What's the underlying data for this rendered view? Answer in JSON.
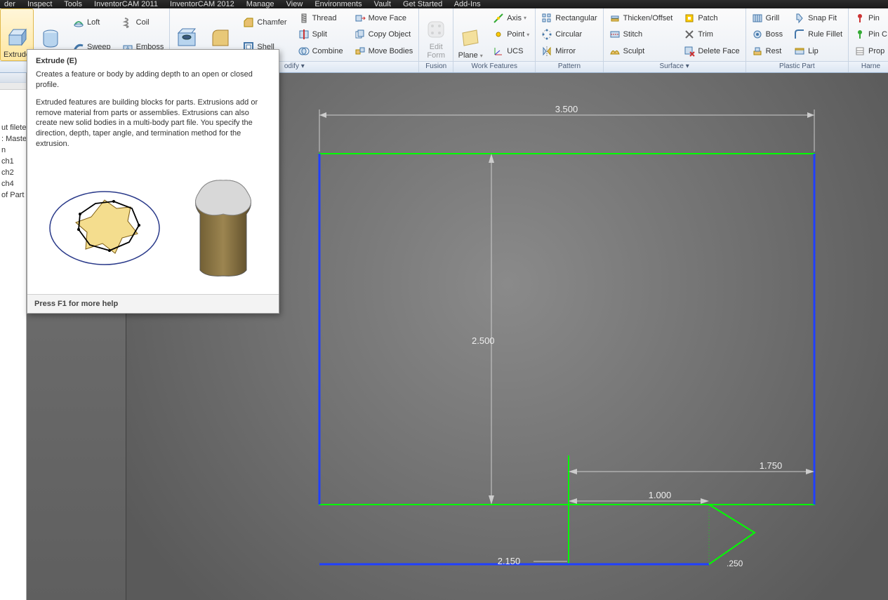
{
  "menu": {
    "items": [
      "der",
      "Inspect",
      "Tools",
      "InventorCAM 2011",
      "InventorCAM 2012",
      "Manage",
      "View",
      "Environments",
      "Vault",
      "Get Started",
      "Add-Ins"
    ]
  },
  "ribbon": {
    "groups": [
      {
        "label": "",
        "big": [
          {
            "name": "extrude-button",
            "text": "Extrude",
            "selected": true,
            "icon": "extrude"
          },
          {
            "name": "revolve-button",
            "text": "Revolve",
            "icon": "revolve"
          }
        ],
        "cols": [
          [
            {
              "name": "loft-button",
              "text": "Loft",
              "icon": "loft"
            },
            {
              "name": "sweep-button",
              "text": "Sweep",
              "icon": "sweep"
            }
          ],
          [
            {
              "name": "coil-button",
              "text": "Coil",
              "icon": "coil"
            },
            {
              "name": "emboss-button",
              "text": "Emboss",
              "icon": "emboss"
            }
          ]
        ]
      },
      {
        "label": "",
        "big": [
          {
            "name": "hole-button",
            "text": "Hole",
            "icon": "hole"
          },
          {
            "name": "fillet-button",
            "text": "Fillet",
            "icon": "fillet",
            "dd": true
          }
        ],
        "cols": [
          [
            {
              "name": "chamfer-button",
              "text": "Chamfer",
              "icon": "chamfer"
            },
            {
              "name": "shell-button",
              "text": "Shell",
              "icon": "shell"
            }
          ],
          [
            {
              "name": "thread-button",
              "text": "Thread",
              "icon": "thread"
            },
            {
              "name": "split-button",
              "text": "Split",
              "icon": "split"
            },
            {
              "name": "combine-button",
              "text": "Combine",
              "icon": "combine"
            }
          ],
          [
            {
              "name": "moveface-button",
              "text": "Move Face",
              "icon": "moveface"
            },
            {
              "name": "copyobject-button",
              "text": "Copy Object",
              "icon": "copy"
            },
            {
              "name": "movebodies-button",
              "text": "Move Bodies",
              "icon": "movebodies"
            }
          ]
        ],
        "partial_label": "odify ▾"
      },
      {
        "label": "Fusion",
        "big": [
          {
            "name": "editform-button",
            "text": "Edit\nForm",
            "icon": "editform",
            "disabled": true
          }
        ]
      },
      {
        "label": "Work Features",
        "big": [
          {
            "name": "plane-button",
            "text": "Plane",
            "icon": "plane",
            "dd": true
          }
        ],
        "cols": [
          [
            {
              "name": "axis-button",
              "text": "Axis",
              "icon": "axis",
              "dd": true
            },
            {
              "name": "point-button",
              "text": "Point",
              "icon": "point",
              "dd": true
            },
            {
              "name": "ucs-button",
              "text": "UCS",
              "icon": "ucs"
            }
          ]
        ]
      },
      {
        "label": "Pattern",
        "cols": [
          [
            {
              "name": "rect-pattern-button",
              "text": "Rectangular",
              "icon": "rectp"
            },
            {
              "name": "circ-pattern-button",
              "text": "Circular",
              "icon": "circp"
            },
            {
              "name": "mirror-button",
              "text": "Mirror",
              "icon": "mirror"
            }
          ]
        ]
      },
      {
        "label": "Surface ▾",
        "cols": [
          [
            {
              "name": "thicken-button",
              "text": "Thicken/Offset",
              "icon": "thicken"
            },
            {
              "name": "stitch-button",
              "text": "Stitch",
              "icon": "stitch"
            },
            {
              "name": "sculpt-button",
              "text": "Sculpt",
              "icon": "sculpt"
            }
          ],
          [
            {
              "name": "patch-button",
              "text": "Patch",
              "icon": "patch"
            },
            {
              "name": "trim-button",
              "text": "Trim",
              "icon": "trim"
            },
            {
              "name": "deleteface-button",
              "text": "Delete Face",
              "icon": "delface"
            }
          ]
        ]
      },
      {
        "label": "Plastic Part",
        "cols": [
          [
            {
              "name": "grill-button",
              "text": "Grill",
              "icon": "grill"
            },
            {
              "name": "boss-button",
              "text": "Boss",
              "icon": "boss"
            },
            {
              "name": "rest-button",
              "text": "Rest",
              "icon": "rest"
            }
          ],
          [
            {
              "name": "snapfit-button",
              "text": "Snap Fit",
              "icon": "snapfit"
            },
            {
              "name": "rulefillet-button",
              "text": "Rule Fillet",
              "icon": "rulef"
            },
            {
              "name": "lip-button",
              "text": "Lip",
              "icon": "lip"
            }
          ]
        ]
      },
      {
        "label": "Harne",
        "cols": [
          [
            {
              "name": "pin-button",
              "text": "Pin",
              "icon": "pin"
            },
            {
              "name": "pinc-button",
              "text": "Pin C",
              "icon": "pinc"
            },
            {
              "name": "prop-button",
              "text": "Prop",
              "icon": "prop"
            }
          ]
        ]
      }
    ]
  },
  "browser": {
    "items": [
      "ut fileted",
      ": Master",
      "n",
      "ch1",
      "ch2",
      "ch4",
      "of Part"
    ]
  },
  "tooltip": {
    "title": "Extrude (E)",
    "p1": "Creates a feature or body by adding depth to an open or closed profile.",
    "p2": "Extruded features are building blocks for parts. Extrusions add or remove material from parts or assemblies. Extrusions can also create new solid bodies in a multi-body part file. You specify the direction, depth, taper angle, and termination method for the extrusion.",
    "footer": "Press F1 for more help"
  },
  "sketch": {
    "dims": {
      "top": "3.500",
      "vert": "2.500",
      "right": "1.750",
      "mid": "1.000",
      "bottom": "2.150",
      "small": ".250"
    }
  }
}
